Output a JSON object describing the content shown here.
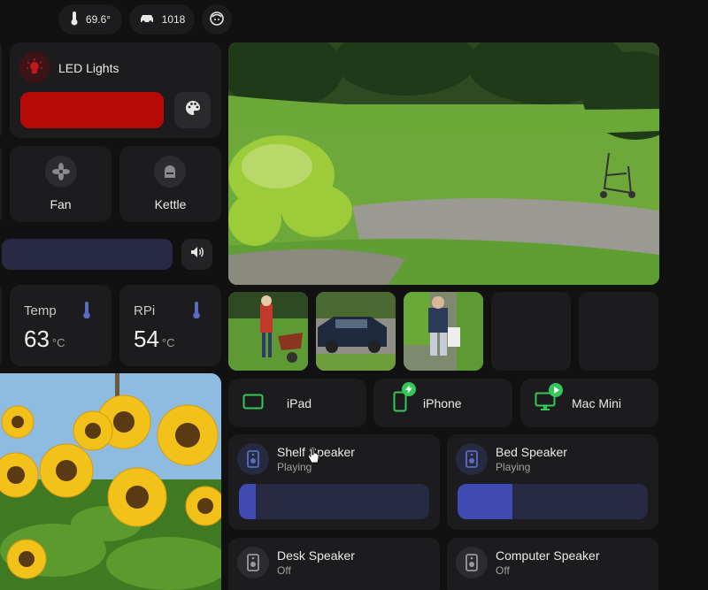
{
  "top_bar": {
    "temperature": "69.6°",
    "car_value": "1018",
    "icons": [
      "thermometer-icon",
      "car-icon",
      "face-icon"
    ]
  },
  "led": {
    "title": "LED Lights",
    "color": "#b70a05",
    "icon": "led-bulb-icon"
  },
  "toggles": [
    {
      "label": "Fan",
      "icon": "fan-icon"
    },
    {
      "label": "Kettle",
      "icon": "kettle-icon"
    }
  ],
  "volume": {
    "level": 0,
    "icon": "volume-icon"
  },
  "sensors": [
    {
      "label": "Temp",
      "value": "63",
      "unit": "°C",
      "icon": "thermometer-icon"
    },
    {
      "label": "RPi",
      "value": "54",
      "unit": "°C",
      "icon": "thermometer-icon"
    }
  ],
  "camera": {
    "main_view": "garden-driveway-camera"
  },
  "devices": [
    {
      "label": "iPad",
      "icon": "tablet-icon",
      "badge": ""
    },
    {
      "label": "iPhone",
      "icon": "phone-icon",
      "badge": "charging"
    },
    {
      "label": "Mac Mini",
      "icon": "monitor-icon",
      "badge": "playing"
    }
  ],
  "speakers": [
    {
      "name": "Shelf Speaker",
      "state": "Playing",
      "volume": 0.09,
      "active": true
    },
    {
      "name": "Bed Speaker",
      "state": "Playing",
      "volume": 0.29,
      "active": true
    },
    {
      "name": "Desk Speaker",
      "state": "Off",
      "volume": 0,
      "active": false
    },
    {
      "name": "Computer Speaker",
      "state": "Off",
      "volume": 0,
      "active": false
    }
  ],
  "colors": {
    "accent_green": "#34c759",
    "speaker_blue": "#3f4bb0",
    "card_bg": "#1c1c1e"
  }
}
